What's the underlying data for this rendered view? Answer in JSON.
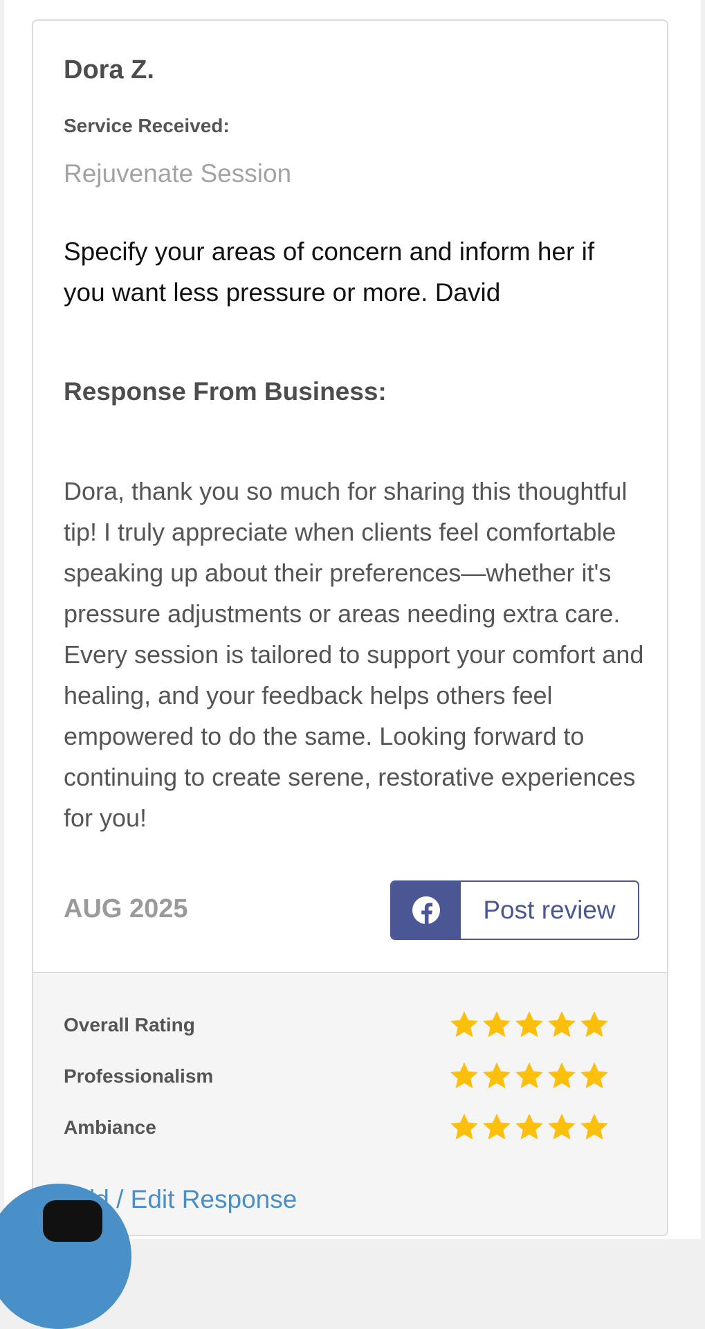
{
  "review": {
    "reviewer_name": "Dora Z.",
    "service_label": "Service Received:",
    "service_value": "Rejuvenate Session",
    "text": "Specify your areas of concern and inform her if you want less pressure or more. David",
    "response_label": "Response From Business:",
    "response_text": "Dora, thank you so much for sharing this thoughtful tip! I truly appreciate when clients feel comfortable speaking up about their preferences—whether it's pressure adjustments or areas needing extra care. Every session is tailored to support your comfort and healing, and your feedback helps others feel empowered to do the same. Looking forward to continuing to create serene, restorative experiences for you!",
    "date": "AUG 2025"
  },
  "share": {
    "icon": "facebook-icon",
    "label": "Post review",
    "color": "#4b5794"
  },
  "ratings": [
    {
      "label": "Overall Rating",
      "stars": 5,
      "max": 5
    },
    {
      "label": "Professionalism",
      "stars": 5,
      "max": 5
    },
    {
      "label": "Ambiance",
      "stars": 5,
      "max": 5
    }
  ],
  "star_color": "#fbbf0c",
  "actions": {
    "add_edit_response": "Add / Edit Response"
  },
  "chat": {
    "icon": "chat-icon",
    "color": "#4a90c8"
  }
}
